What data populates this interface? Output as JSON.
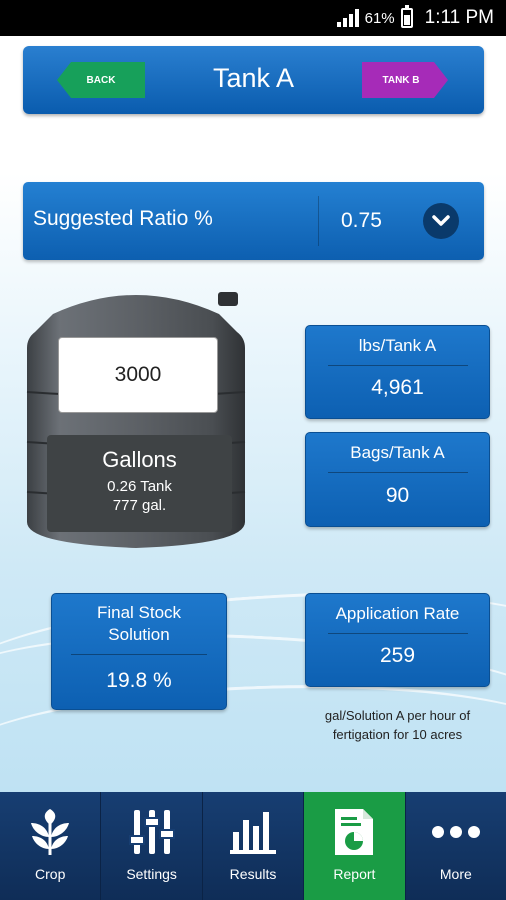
{
  "status_bar": {
    "battery": "61%",
    "time": "1:11 PM"
  },
  "header": {
    "title": "Tank A",
    "back_label": "BACK",
    "next_label": "TANK B"
  },
  "ratio": {
    "label": "Suggested Ratio %",
    "value": "0.75",
    "dropdown_icon": "chevron-down-icon"
  },
  "tank": {
    "volume_input": "3000",
    "unit_label": "Gallons",
    "tank_fraction": "0.26 Tank",
    "gallons_text": "777 gal."
  },
  "cards": {
    "lbs": {
      "label": "lbs/Tank A",
      "value": "4,961"
    },
    "bags": {
      "label": "Bags/Tank A",
      "value": "90"
    },
    "stock": {
      "label": "Final Stock Solution",
      "value": "19.8 %"
    },
    "rate": {
      "label": "Application Rate",
      "value": "259"
    }
  },
  "rate_note": "gal/Solution A per hour of fertigation for 10 acres",
  "nav": [
    {
      "label": "Crop",
      "icon": "leaf-icon"
    },
    {
      "label": "Settings",
      "icon": "sliders-icon"
    },
    {
      "label": "Results",
      "icon": "bar-chart-icon"
    },
    {
      "label": "Report",
      "icon": "report-icon",
      "active": true
    },
    {
      "label": "More",
      "icon": "more-icon"
    }
  ],
  "colors": {
    "header_blue": "#0a5cae",
    "back_green": "#17a05a",
    "tankb_purple": "#a62bb8",
    "nav_active_green": "#1a9c45",
    "nav_bg": "#173e72"
  }
}
